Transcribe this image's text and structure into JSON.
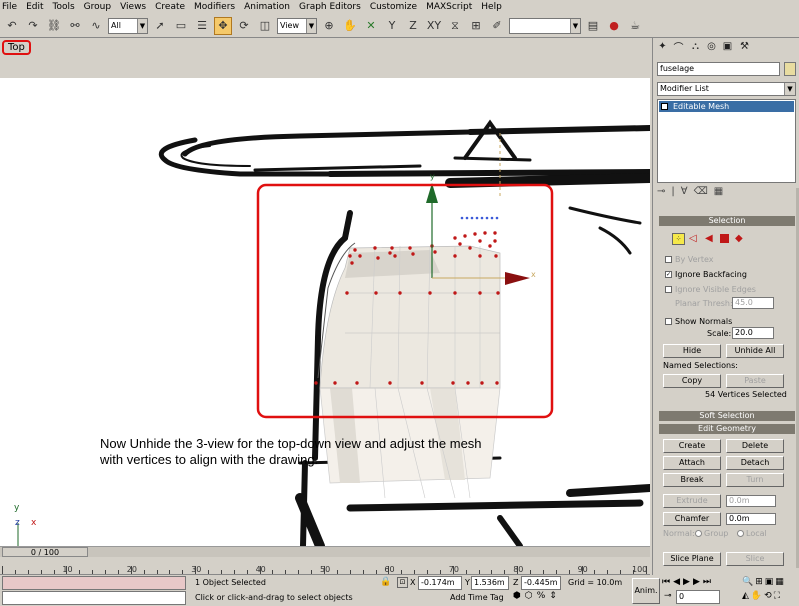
{
  "menu": [
    "File",
    "Edit",
    "Tools",
    "Group",
    "Views",
    "Create",
    "Modifiers",
    "Animation",
    "Graph Editors",
    "Customize",
    "MAXScript",
    "Help"
  ],
  "toolbar": {
    "selection_filter": "All",
    "ref_coord": "View",
    "named_selection": ""
  },
  "viewport": {
    "label": "Top",
    "instruction_line1": "Now Unhide the 3-view for the top-down view and adjust the mesh",
    "instruction_line2": "with vertices to align with the drawing.",
    "axis_x": "x",
    "axis_y": "y",
    "axis_z": "z"
  },
  "timeline": {
    "thumb": "0 / 100",
    "ticks": [
      "10",
      "20",
      "30",
      "40",
      "50",
      "60",
      "70",
      "80",
      "90",
      "100"
    ]
  },
  "status": {
    "selected": "1 Object Selected",
    "prompt": "Click or click-and-drag to select objects",
    "x_label": "X",
    "x_value": "-0.174m",
    "y_label": "Y",
    "y_value": "1.536m",
    "z_label": "Z",
    "z_value": "-0.445m",
    "grid": "Grid = 10.0m",
    "add_time_tag": "Add Time Tag",
    "anim": "Anim.",
    "frame": "0"
  },
  "panel": {
    "object_name": "fuselage",
    "object_color": "#e8dca0",
    "modifier_list": "Modifier List",
    "stack_item": "Editable Mesh",
    "selection_title": "Selection",
    "by_vertex": "By Vertex",
    "ignore_backfacing": "Ignore Backfacing",
    "ignore_visible_edges": "Ignore Visible Edges",
    "planar_thresh": "Planar Thresh:",
    "planar_value": "45.0",
    "show_normals": "Show Normals",
    "scale_label": "Scale:",
    "scale_value": "20.0",
    "hide": "Hide",
    "unhide_all": "Unhide All",
    "named_selections": "Named Selections:",
    "copy": "Copy",
    "paste": "Paste",
    "vertices_selected": "54 Vertices Selected",
    "soft_selection": "Soft Selection",
    "edit_geometry": "Edit Geometry",
    "create": "Create",
    "delete": "Delete",
    "attach": "Attach",
    "detach": "Detach",
    "break": "Break",
    "turn": "Turn",
    "extrude": "Extrude",
    "extrude_value": "0.0m",
    "chamfer": "Chamfer",
    "chamfer_value": "0.0m",
    "normal_label": "Normal:",
    "group_label": "Group",
    "local_label": "Local",
    "slice_plane": "Slice Plane",
    "slice": "Slice"
  },
  "colors": {
    "accent_red": "#e01010",
    "rollout": "#7e7a70",
    "stack_highlight": "#3a6ea5"
  }
}
